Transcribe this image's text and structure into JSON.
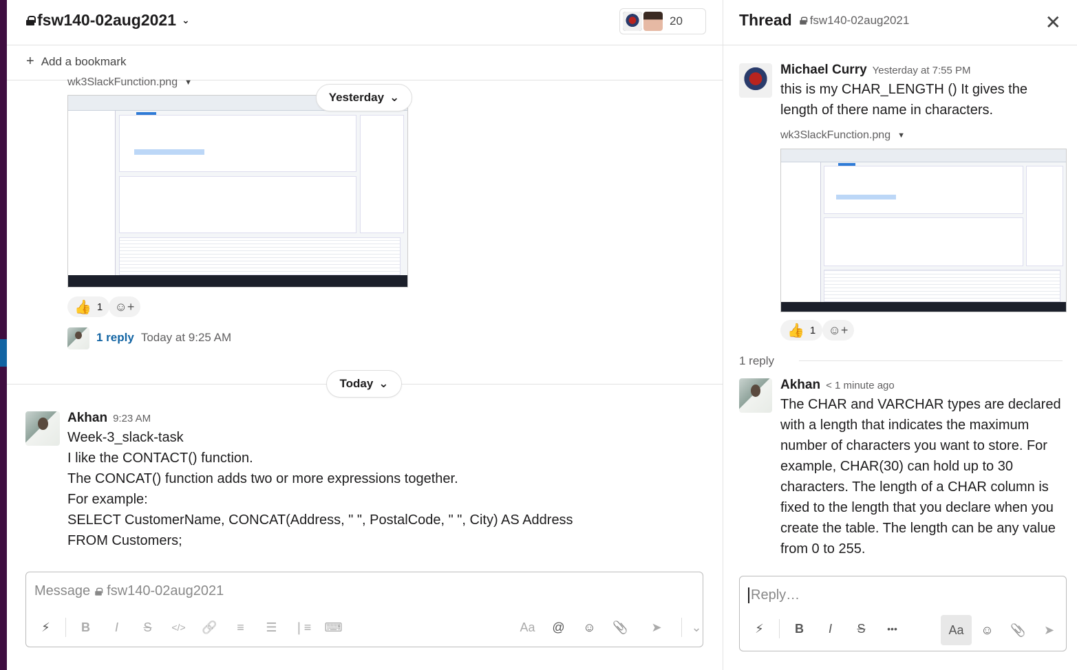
{
  "channel": {
    "name": "fsw140-02aug2021",
    "member_count": "20",
    "bookmark": "Add a bookmark"
  },
  "first_message": {
    "file_name": "wk3SlackFunction.png",
    "reaction_emoji": "👍",
    "reaction_count": "1",
    "reply_count": "1 reply",
    "reply_time": "Today at 9:25 AM"
  },
  "date_dividers": {
    "yesterday": "Yesterday",
    "today": "Today"
  },
  "second_message": {
    "author": "Akhan",
    "time": "9:23 AM",
    "lines": [
      "Week-3_slack-task",
      "I like the CONTACT() function.",
      "The CONCAT() function adds two or more expressions together.",
      "For example:",
      "SELECT CustomerName, CONCAT(Address, \" \", PostalCode, \" \", City) AS Address",
      "FROM Customers;"
    ]
  },
  "composer": {
    "placeholder_prefix": "Message",
    "placeholder_channel": "fsw140-02aug2021"
  },
  "thread": {
    "title": "Thread",
    "channel": "fsw140-02aug2021",
    "parent": {
      "author": "Michael Curry",
      "time": "Yesterday at 7:55 PM",
      "text": "this is my CHAR_LENGTH () It gives the length of there name in characters.",
      "file_name": "wk3SlackFunction.png",
      "reaction_emoji": "👍",
      "reaction_count": "1"
    },
    "reply_count": "1 reply",
    "reply": {
      "author": "Akhan",
      "time": "< 1 minute ago",
      "text": "The CHAR and VARCHAR types are declared with a length that indicates the maximum number of characters you want to store. For example, CHAR(30) can hold up to 30 characters. The length of a CHAR column is fixed to the length that you declare when you create the table. The length can be any value from 0 to 255."
    },
    "composer_placeholder": "Reply…"
  },
  "icons": {
    "lightning": "⚡",
    "bold": "B",
    "italic": "I",
    "strike": "S",
    "code": "</>",
    "link": "🔗",
    "ordered_list": "≡",
    "bullet_list": "☰",
    "blockquote": "❘≡",
    "code_block": "⌨",
    "format": "Aa",
    "mention": "@",
    "emoji": "☺",
    "attach": "📎",
    "send": "➤",
    "dropdown": "⌄",
    "more": "•••",
    "close": "✕",
    "plus": "+",
    "add_reaction": "☺+"
  },
  "colors": {
    "aubergine": "#3f0e40",
    "link_blue": "#1264a3",
    "selected_blue": "#1164a3"
  }
}
